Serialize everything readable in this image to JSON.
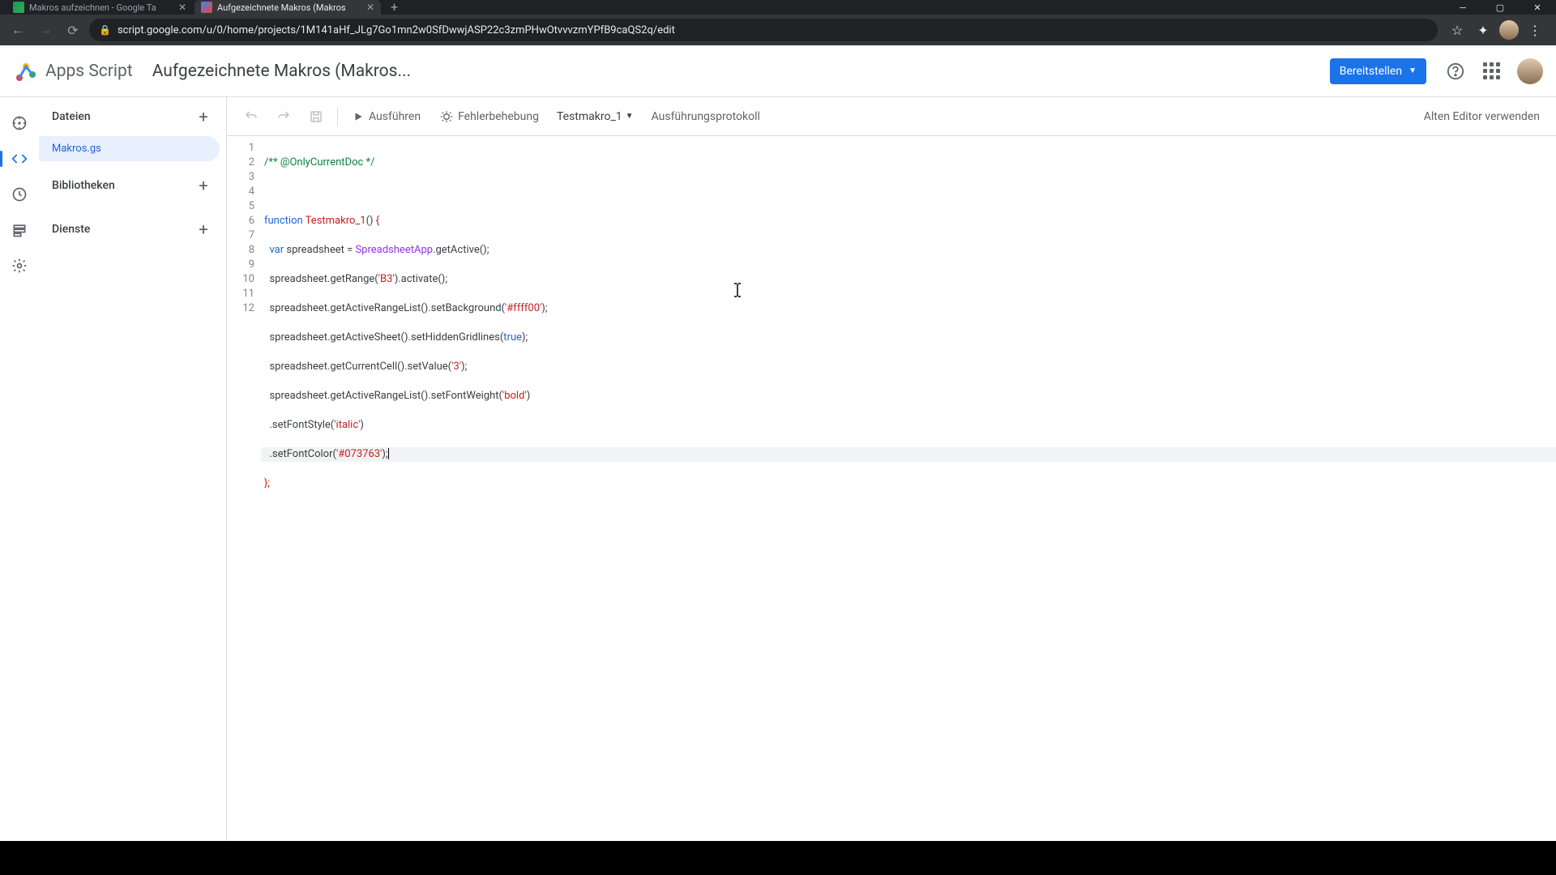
{
  "browser": {
    "tabs": [
      {
        "title": "Makros aufzeichnen - Google Ta"
      },
      {
        "title": "Aufgezeichnete Makros (Makros"
      }
    ],
    "url": "script.google.com/u/0/home/projects/1M141aHf_JLg7Go1mn2w0SfDwwjASP22c3zmPHwOtvvvzmYPfB9caQS2q/edit"
  },
  "header": {
    "logo_text": "Apps Script",
    "project_title": "Aufgezeichnete Makros (Makros...",
    "deploy_label": "Bereitstellen"
  },
  "panel": {
    "files_label": "Dateien",
    "file_name": "Makros.gs",
    "libs_label": "Bibliotheken",
    "services_label": "Dienste"
  },
  "toolbar": {
    "run_label": "Ausführen",
    "debug_label": "Fehlerbehebung",
    "fn_selected": "Testmakro_1",
    "log_label": "Ausführungsprotokoll",
    "legacy_label": "Alten Editor verwenden"
  },
  "code": {
    "line_numbers": [
      "1",
      "2",
      "3",
      "4",
      "5",
      "6",
      "7",
      "8",
      "9",
      "10",
      "11",
      "12"
    ],
    "l1_comment": "/** @OnlyCurrentDoc */",
    "l3_kw": "function",
    "l3_fn": "Testmakro_1",
    "l3_rest": "() ",
    "l4_kw": "var",
    "l4_a": " spreadsheet = ",
    "l4_cls": "SpreadsheetApp",
    "l4_b": ".getActive();",
    "l5": "  spreadsheet.getRange(",
    "l5_str": "'B3'",
    "l5_b": ").activate();",
    "l6": "  spreadsheet.getActiveRangeList().setBackground(",
    "l6_str": "'#ffff00'",
    "l6_b": ");",
    "l7": "  spreadsheet.getActiveSheet().setHiddenGridlines(",
    "l7_bool": "true",
    "l7_b": ");",
    "l8": "  spreadsheet.getCurrentCell().setValue(",
    "l8_str": "'3'",
    "l8_b": ");",
    "l9": "  spreadsheet.getActiveRangeList().setFontWeight(",
    "l9_str": "'bold'",
    "l9_b": ")",
    "l10": "  .setFontStyle(",
    "l10_str": "'italic'",
    "l10_b": ")",
    "l11": "  .setFontColor(",
    "l11_str": "'#073763'",
    "l11_b": ");",
    "l12": "};"
  }
}
